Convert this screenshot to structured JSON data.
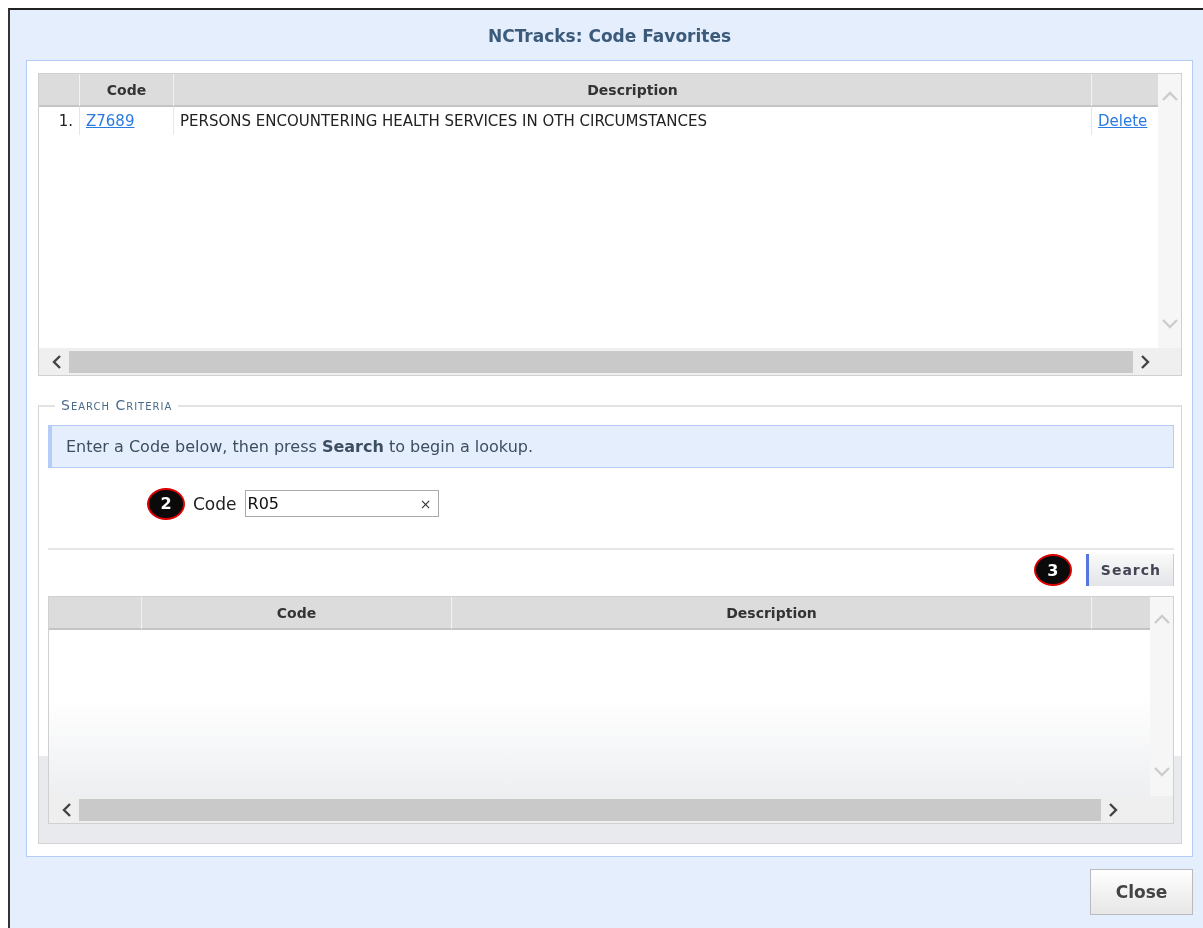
{
  "window": {
    "title": "NCTracks: Code Favorites"
  },
  "favorites_table": {
    "columns": [
      "Code",
      "Description"
    ],
    "rows": [
      {
        "index": "1.",
        "code": "Z7689",
        "description": "PERSONS ENCOUNTERING HEALTH SERVICES IN OTH CIRCUMSTANCES",
        "action": "Delete"
      }
    ]
  },
  "search_criteria": {
    "legend": "Search Criteria",
    "info": "Enter a Code below, then press **Search** to begin a lookup.",
    "code_field": {
      "callout": "2",
      "label": "Code",
      "value": "R05",
      "clear": "×"
    },
    "search_button": {
      "callout": "3",
      "label": "Search"
    }
  },
  "results_table": {
    "columns": [
      "Code",
      "Description"
    ]
  },
  "buttons": [
    "Close"
  ]
}
